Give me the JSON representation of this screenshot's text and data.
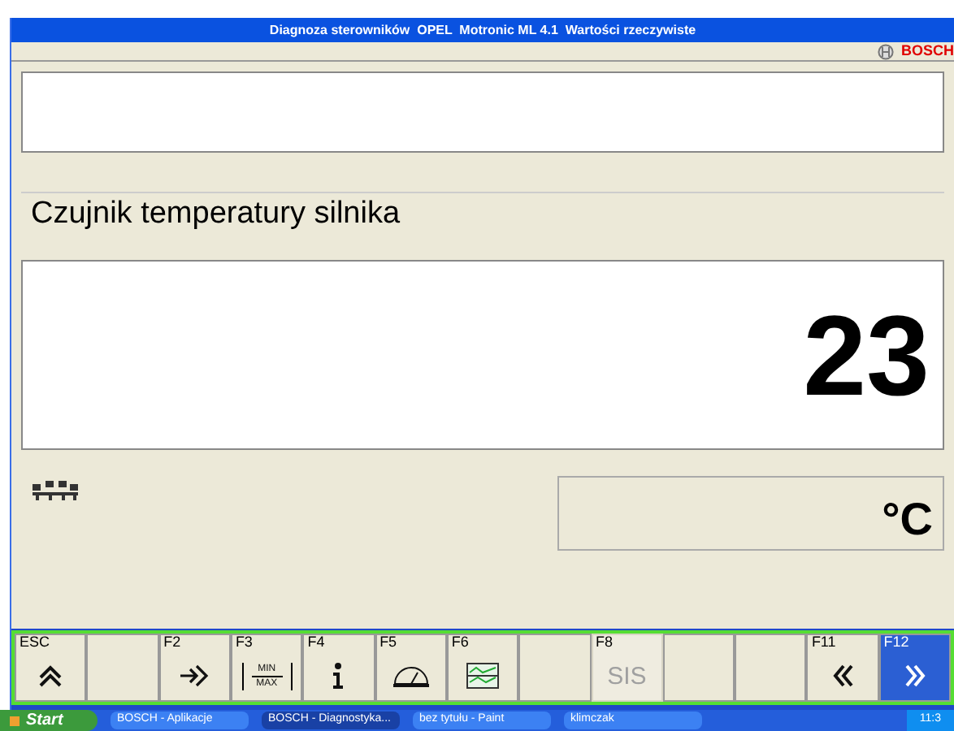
{
  "window": {
    "title": "Diagnoza sterowników  OPEL  Motronic ML 4.1  Wartości rzeczywiste"
  },
  "brand": "BOSCH",
  "parameter": {
    "name": "Czujnik temperatury silnika",
    "value": "23",
    "unit": "°C"
  },
  "function_keys": [
    {
      "key": "ESC",
      "kind": "up",
      "selected": false,
      "disabled": false
    },
    {
      "kind": "empty",
      "selected": false,
      "disabled": false
    },
    {
      "key": "F2",
      "kind": "enter",
      "selected": false,
      "disabled": false
    },
    {
      "key": "F3",
      "kind": "minmax",
      "label_top": "MIN",
      "label_bottom": "MAX",
      "selected": false,
      "disabled": false
    },
    {
      "key": "F4",
      "kind": "info",
      "selected": false,
      "disabled": false
    },
    {
      "key": "F5",
      "kind": "gauge",
      "selected": false,
      "disabled": false
    },
    {
      "key": "F6",
      "kind": "graph",
      "selected": false,
      "disabled": false
    },
    {
      "kind": "empty",
      "selected": false,
      "disabled": false
    },
    {
      "key": "F8",
      "kind": "text",
      "label": "SIS",
      "selected": false,
      "disabled": true
    },
    {
      "kind": "empty",
      "selected": false,
      "disabled": false
    },
    {
      "kind": "empty",
      "selected": false,
      "disabled": false
    },
    {
      "key": "F11",
      "kind": "prev",
      "selected": false,
      "disabled": false
    },
    {
      "key": "F12",
      "kind": "next",
      "selected": true,
      "disabled": false
    }
  ],
  "taskbar": {
    "start": "Start",
    "tasks": [
      {
        "label": "BOSCH - Aplikacje",
        "selected": false
      },
      {
        "label": "BOSCH - Diagnostyka...",
        "selected": true
      },
      {
        "label": "bez tytułu - Paint",
        "selected": false
      },
      {
        "label": "klimczak",
        "selected": false
      }
    ],
    "clock": "11:3"
  }
}
